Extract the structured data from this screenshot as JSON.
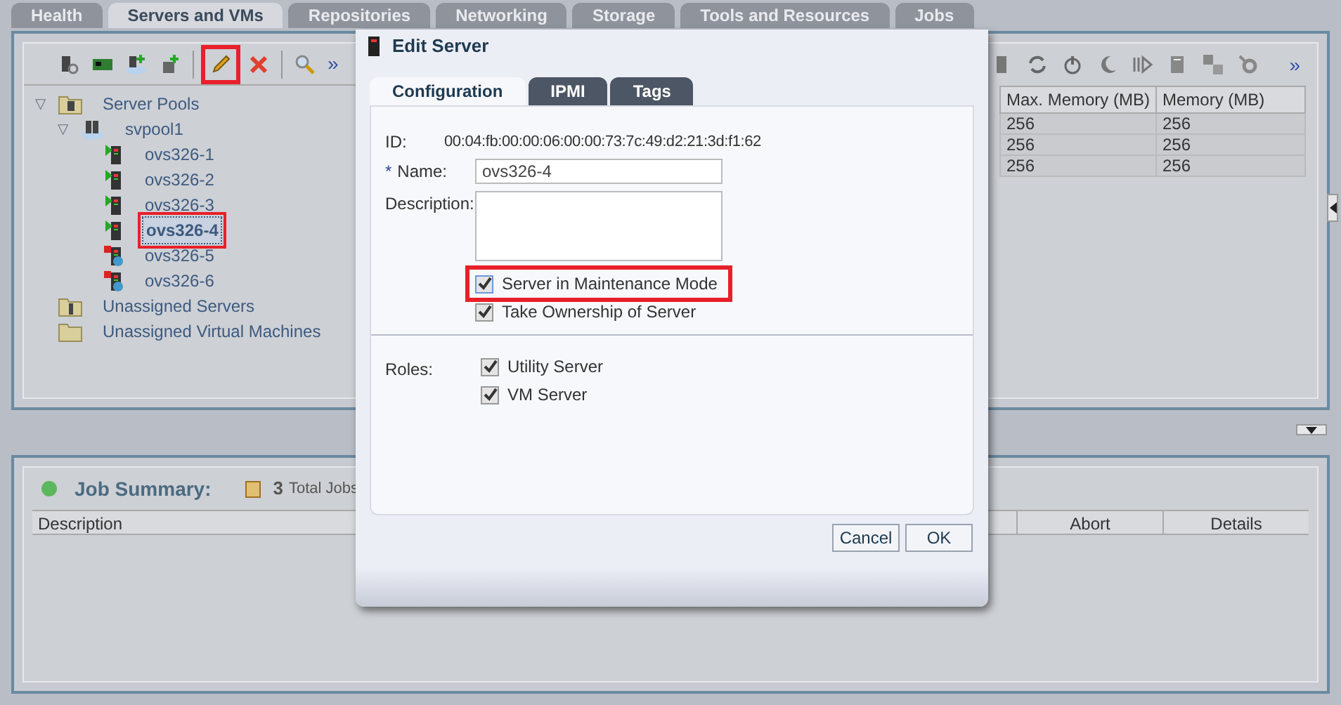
{
  "top_tabs": [
    {
      "label": "Health",
      "selected": false
    },
    {
      "label": "Servers and VMs",
      "selected": true
    },
    {
      "label": "Repositories",
      "selected": false
    },
    {
      "label": "Networking",
      "selected": false
    },
    {
      "label": "Storage",
      "selected": false
    },
    {
      "label": "Tools and Resources",
      "selected": false
    },
    {
      "label": "Jobs",
      "selected": false
    }
  ],
  "toolbar": {
    "edit_highlighted": true,
    "more": "»",
    "right_more": "»"
  },
  "tree": [
    {
      "label": "Server Pools",
      "kind": "pools",
      "expanded": true,
      "expander": "▽",
      "children": [
        {
          "label": "svpool1",
          "kind": "pool",
          "expanded": true,
          "expander": "▽",
          "children": [
            {
              "label": "ovs326-1",
              "kind": "running",
              "selected": false
            },
            {
              "label": "ovs326-2",
              "kind": "running",
              "selected": false
            },
            {
              "label": "ovs326-3",
              "kind": "running",
              "selected": false
            },
            {
              "label": "ovs326-4",
              "kind": "running",
              "selected": true
            },
            {
              "label": "ovs326-5",
              "kind": "stopped",
              "selected": false
            },
            {
              "label": "ovs326-6",
              "kind": "stopped",
              "selected": false
            }
          ]
        }
      ]
    },
    {
      "label": "Unassigned Servers",
      "kind": "servers"
    },
    {
      "label": "Unassigned Virtual Machines",
      "kind": "folder"
    }
  ],
  "table": {
    "columns": [
      "Max. Memory (MB)",
      "Memory (MB)"
    ],
    "rows": [
      [
        "256",
        "256"
      ],
      [
        "256",
        "256"
      ],
      [
        "256",
        "256"
      ]
    ]
  },
  "job_summary": {
    "title": "Job Summary:",
    "count": "3",
    "count_label": "Total Jobs",
    "columns": [
      "Description",
      "Abort",
      "Details"
    ]
  },
  "dialog": {
    "title": "Edit Server",
    "tabs": [
      {
        "label": "Configuration",
        "selected": true
      },
      {
        "label": "IPMI",
        "selected": false
      },
      {
        "label": "Tags",
        "selected": false
      }
    ],
    "id_label": "ID:",
    "id_value": "00:04:fb:00:00:06:00:00:73:7c:49:d2:21:3d:f1:62",
    "required_mark": "*",
    "name_label": "Name:",
    "name_value": "ovs326-4",
    "description_label": "Description:",
    "options": [
      {
        "label": "Server in Maintenance Mode",
        "checked": true,
        "highlighted": true
      },
      {
        "label": "Take Ownership of Server",
        "checked": true,
        "highlighted": false
      }
    ],
    "roles_label": "Roles:",
    "roles": [
      {
        "label": "Utility Server",
        "checked": true
      },
      {
        "label": "VM Server",
        "checked": true
      }
    ],
    "buttons": [
      "Cancel",
      "OK"
    ]
  }
}
